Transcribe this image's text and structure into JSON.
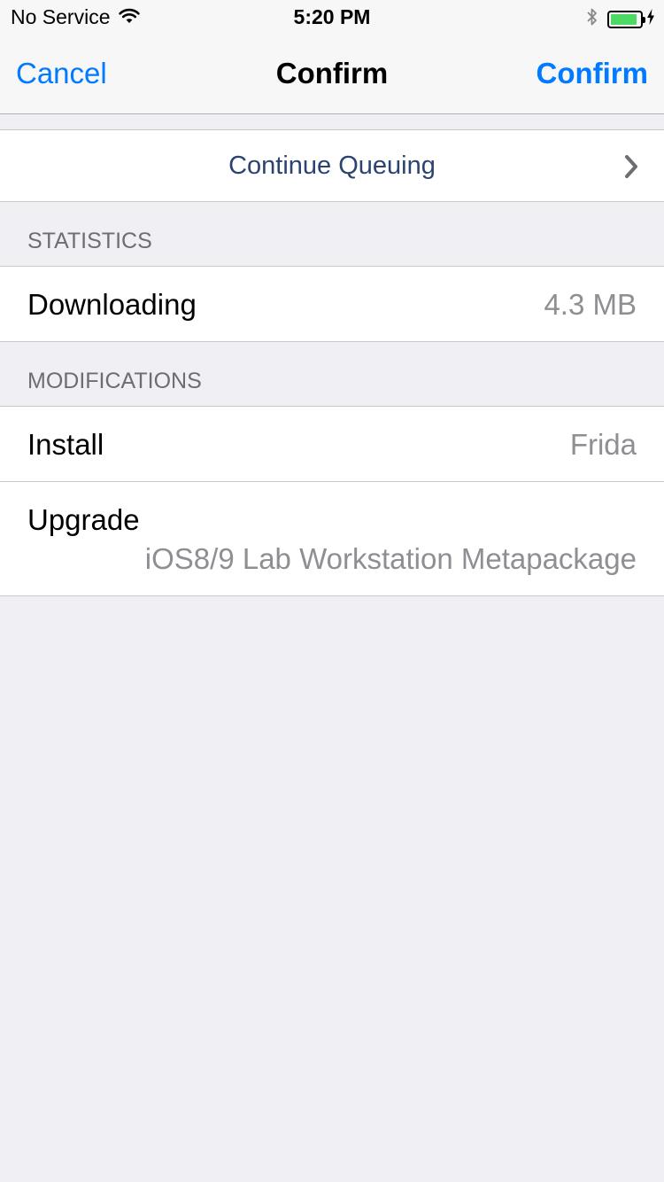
{
  "status_bar": {
    "carrier": "No Service",
    "time": "5:20 PM",
    "battery_level": 0.9
  },
  "nav": {
    "cancel_label": "Cancel",
    "title": "Confirm",
    "confirm_label": "Confirm"
  },
  "queue": {
    "continue_label": "Continue Queuing"
  },
  "statistics": {
    "header": "STATISTICS",
    "downloading_label": "Downloading",
    "downloading_value": "4.3 MB"
  },
  "modifications": {
    "header": "MODIFICATIONS",
    "items": [
      {
        "action": "Install",
        "package": "Frida"
      },
      {
        "action": "Upgrade",
        "package": "iOS8/9 Lab Workstation Metapackage"
      }
    ]
  },
  "colors": {
    "accent": "#007aff",
    "battery": "#4cd964",
    "background": "#efeff4"
  }
}
